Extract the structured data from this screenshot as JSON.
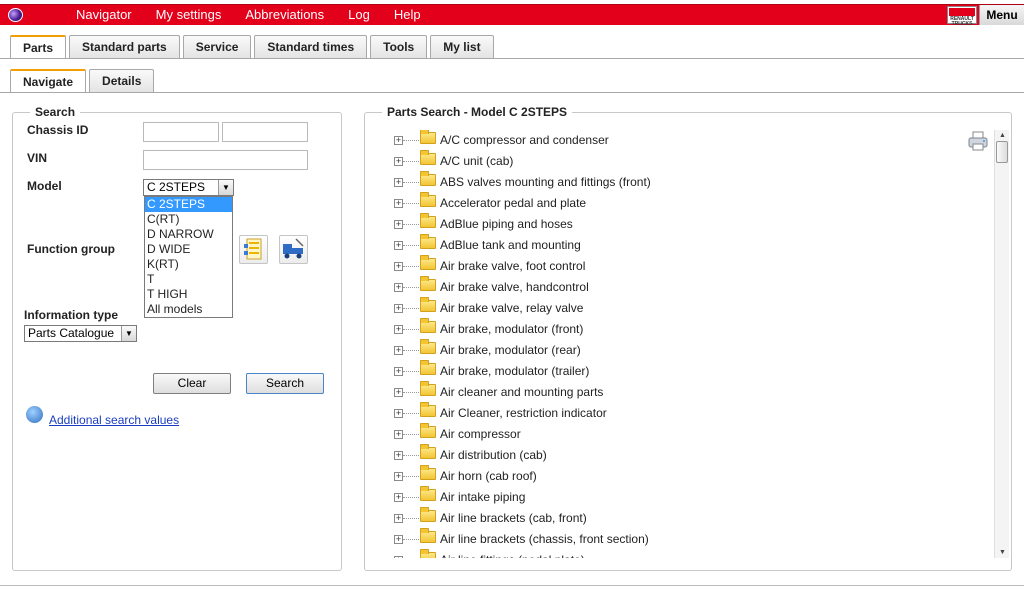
{
  "topbar": {
    "nav": [
      "Navigator",
      "My settings",
      "Abbreviations",
      "Log",
      "Help"
    ],
    "logo_text": "RENAULT TRUCKS",
    "menu_label": "Menu"
  },
  "tabs_main": [
    "Parts",
    "Standard parts",
    "Service",
    "Standard times",
    "Tools",
    "My list"
  ],
  "tabs_sub": [
    "Navigate",
    "Details"
  ],
  "search": {
    "legend": "Search",
    "chassis_label": "Chassis ID",
    "vin_label": "VIN",
    "model_label": "Model",
    "model_selected": "C 2STEPS",
    "model_options": [
      "C 2STEPS",
      "C(RT)",
      "D NARROW",
      "D WIDE",
      "K(RT)",
      "T",
      "T HIGH",
      "All models"
    ],
    "function_group_label": "Function group",
    "info_type_label": "Information type",
    "info_type_value": "Parts Catalogue",
    "clear_label": "Clear",
    "search_label": "Search",
    "additional_link": "Additional search values"
  },
  "results": {
    "legend": "Parts Search - Model C 2STEPS",
    "items": [
      "A/C compressor and condenser",
      "A/C unit (cab)",
      "ABS valves mounting and fittings (front)",
      "Accelerator pedal and plate",
      "AdBlue piping and hoses",
      "AdBlue tank and mounting",
      "Air brake valve, foot control",
      "Air brake valve, handcontrol",
      "Air brake valve, relay valve",
      "Air brake, modulator (front)",
      "Air brake, modulator (rear)",
      "Air brake, modulator (trailer)",
      "Air cleaner and mounting parts",
      "Air Cleaner, restriction indicator",
      "Air compressor",
      "Air distribution (cab)",
      "Air horn (cab roof)",
      "Air intake piping",
      "Air line brackets (cab, front)",
      "Air line brackets (chassis, front section)",
      "Air line fittings (pedal plate)"
    ]
  }
}
